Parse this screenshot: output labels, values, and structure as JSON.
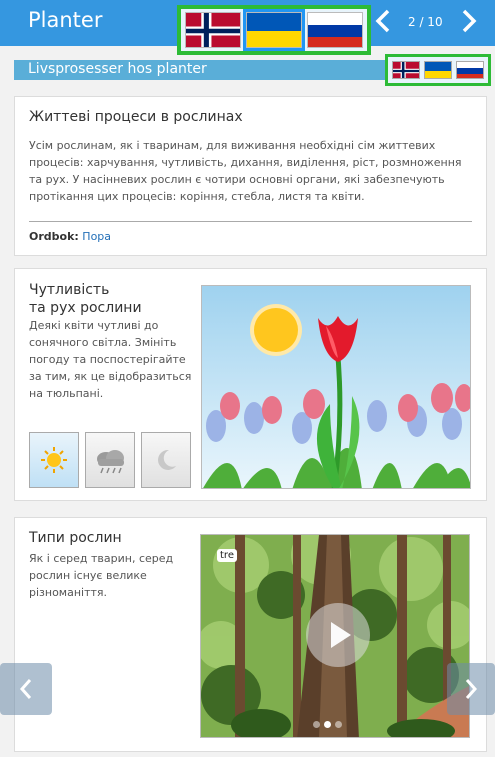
{
  "header": {
    "title": "Planter",
    "page_counter": "2 / 10",
    "prev_icon": "chevron-left-icon",
    "next_icon": "chevron-right-icon",
    "languages": [
      "Norwegian",
      "Ukrainian",
      "Russian"
    ],
    "selected_language": "Ukrainian",
    "accent_color": "#3597e0",
    "highlight_color": "#2dbb36"
  },
  "section": {
    "title": "Livsprosesser hos planter"
  },
  "card_life": {
    "title": "Життеві процеси в рослинах",
    "body": "Усім рослинам, як і тваринам, для виживання необхідні сім життевих процесів: харчування, чутливість, дихання, виділення, ріст, розмноження та рух. У насінневих рослин є чотири основні органи, які забезпечують протікання цих процесів: коріння, стебла, листя та квіти.",
    "dict_label": "Ordbok:",
    "dict_link": "Пора"
  },
  "card_sense": {
    "title_line1": "Чутливість",
    "title_line2": "та рух рослини",
    "body": "Деякі квіти чутливі до сонячного світла. Змініть погоду та поспостерігайте за тим, як це відобразиться на тюльпані.",
    "weather_buttons": [
      "sun-icon",
      "cloud-rain-icon",
      "moon-icon"
    ],
    "selected_weather": "sun-icon"
  },
  "card_types": {
    "title": "Типи рослин",
    "body": "Як і серед тварин, серед рослин існує велике різноманіття.",
    "image_tag": "tre",
    "slide_dots": 3,
    "active_dot": 1
  }
}
